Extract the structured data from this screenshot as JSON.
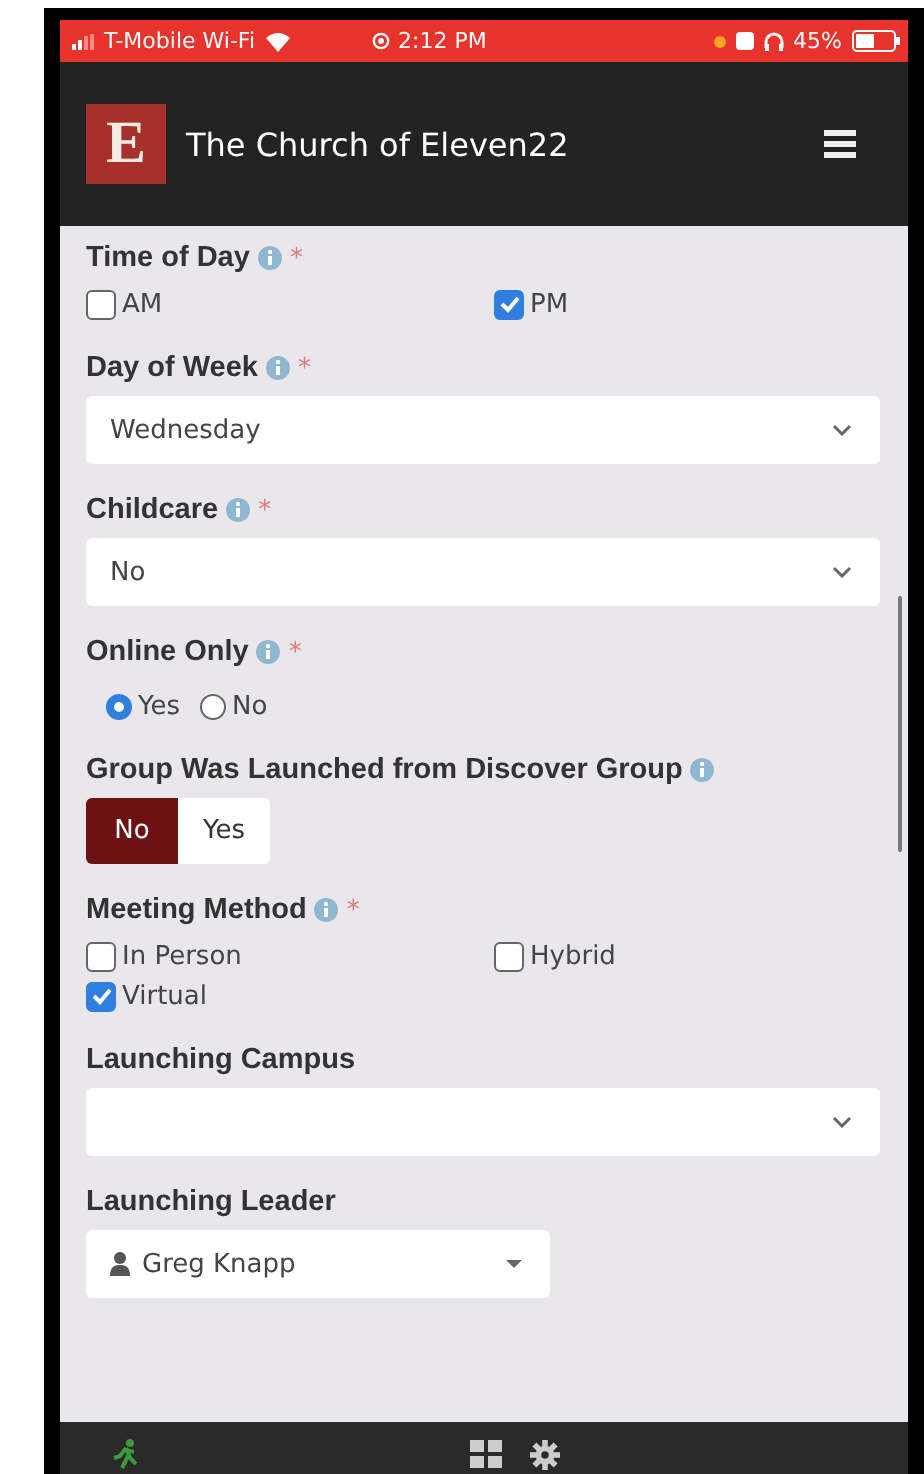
{
  "status_bar": {
    "carrier": "T-Mobile Wi-Fi",
    "time": "2:12 PM",
    "battery": "45%"
  },
  "header": {
    "logo_letter": "E",
    "title": "The Church of Eleven22"
  },
  "fields": [
    {
      "kind": "checkboxes",
      "label": "Time of Day",
      "info": true,
      "required_mark": "*",
      "options": [
        {
          "label": "AM",
          "checked": false
        },
        {
          "label": "PM",
          "checked": true
        }
      ]
    },
    {
      "kind": "select",
      "label": "Day of Week",
      "info": true,
      "required_mark": "*",
      "value": "Wednesday"
    },
    {
      "kind": "select",
      "label": "Childcare",
      "info": true,
      "required_mark": "*",
      "value": "No"
    },
    {
      "kind": "radios",
      "label": "Online Only",
      "info": true,
      "required_mark": "*",
      "options": [
        {
          "label": "Yes",
          "selected": true
        },
        {
          "label": "No",
          "selected": false
        }
      ]
    },
    {
      "kind": "toggle",
      "label": "Group Was Launched from Discover Group",
      "info": true,
      "options": [
        {
          "label": "No",
          "selected": true
        },
        {
          "label": "Yes",
          "selected": false
        }
      ]
    },
    {
      "kind": "checkboxes",
      "label": "Meeting Method",
      "info": true,
      "required_mark": "*",
      "options": [
        {
          "label": "In Person",
          "checked": false
        },
        {
          "label": "Hybrid",
          "checked": false
        },
        {
          "label": "Virtual",
          "checked": true
        }
      ]
    },
    {
      "kind": "select",
      "label": "Launching Campus"
    },
    {
      "kind": "person",
      "label": "Launching Leader",
      "value": "Greg Knapp"
    }
  ]
}
